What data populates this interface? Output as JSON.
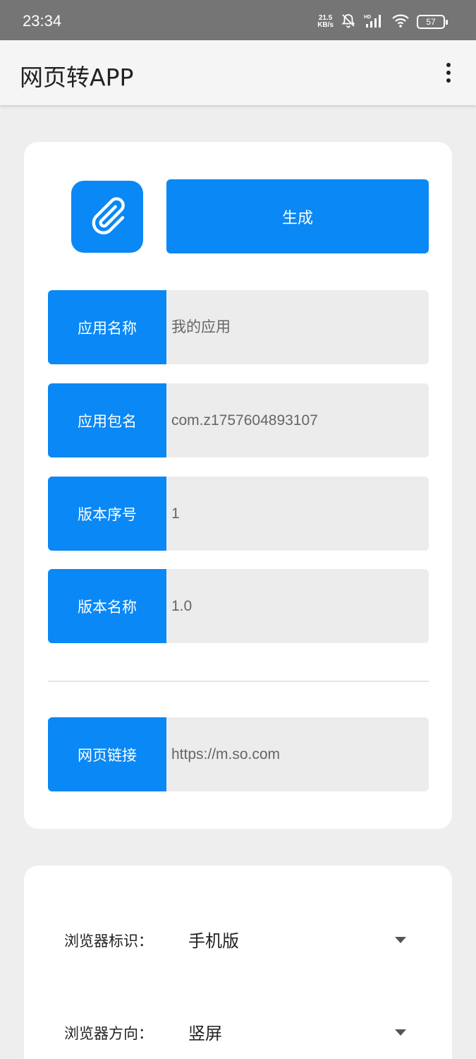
{
  "status_bar": {
    "time": "23:34",
    "net_speed_value": "21.5",
    "net_speed_unit": "KB/s",
    "battery": "57",
    "icons": [
      "mute-bell-icon",
      "hd-signal-icon",
      "wifi-icon",
      "battery-icon"
    ]
  },
  "app_bar": {
    "title": "网页转APP",
    "menu_icon": "more-vert-icon"
  },
  "generator": {
    "icon": "paperclip-icon",
    "generate_label": "生成"
  },
  "fields": {
    "app_name": {
      "label": "应用名称",
      "value": "我的应用"
    },
    "package_name": {
      "label": "应用包名",
      "value": "com.z1757604893107"
    },
    "version_code": {
      "label": "版本序号",
      "value": "1"
    },
    "version_name": {
      "label": "版本名称",
      "value": "1.0"
    },
    "web_url": {
      "label": "网页链接",
      "value": "https://m.so.com"
    }
  },
  "settings": {
    "user_agent": {
      "label": "浏览器标识：",
      "value": "手机版"
    },
    "orientation": {
      "label": "浏览器方向：",
      "value": "竖屏"
    }
  },
  "colors": {
    "accent": "#0a88f5",
    "field_bg": "#ececec",
    "page_bg": "#eeeeee",
    "status_bar": "#757575"
  }
}
